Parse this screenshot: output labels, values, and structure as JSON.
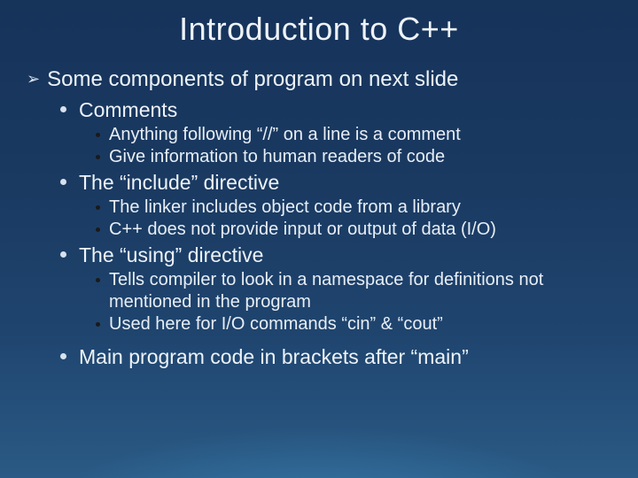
{
  "title": "Introduction to C++",
  "l1_text": "Some components of program on next slide",
  "sections": [
    {
      "heading": "Comments",
      "points": [
        "Anything following “//” on a line is a comment",
        "Give information to human readers of code"
      ]
    },
    {
      "heading": "The “include” directive",
      "points": [
        "The linker includes object code from a library",
        "C++ does not provide input or output of data (I/O)"
      ]
    },
    {
      "heading": "The “using” directive",
      "points": [
        "Tells compiler to look in a namespace for definitions not mentioned in the program",
        "Used here for I/O commands “cin” & “cout”"
      ]
    },
    {
      "heading": "Main program code in brackets after “main”",
      "points": []
    }
  ]
}
